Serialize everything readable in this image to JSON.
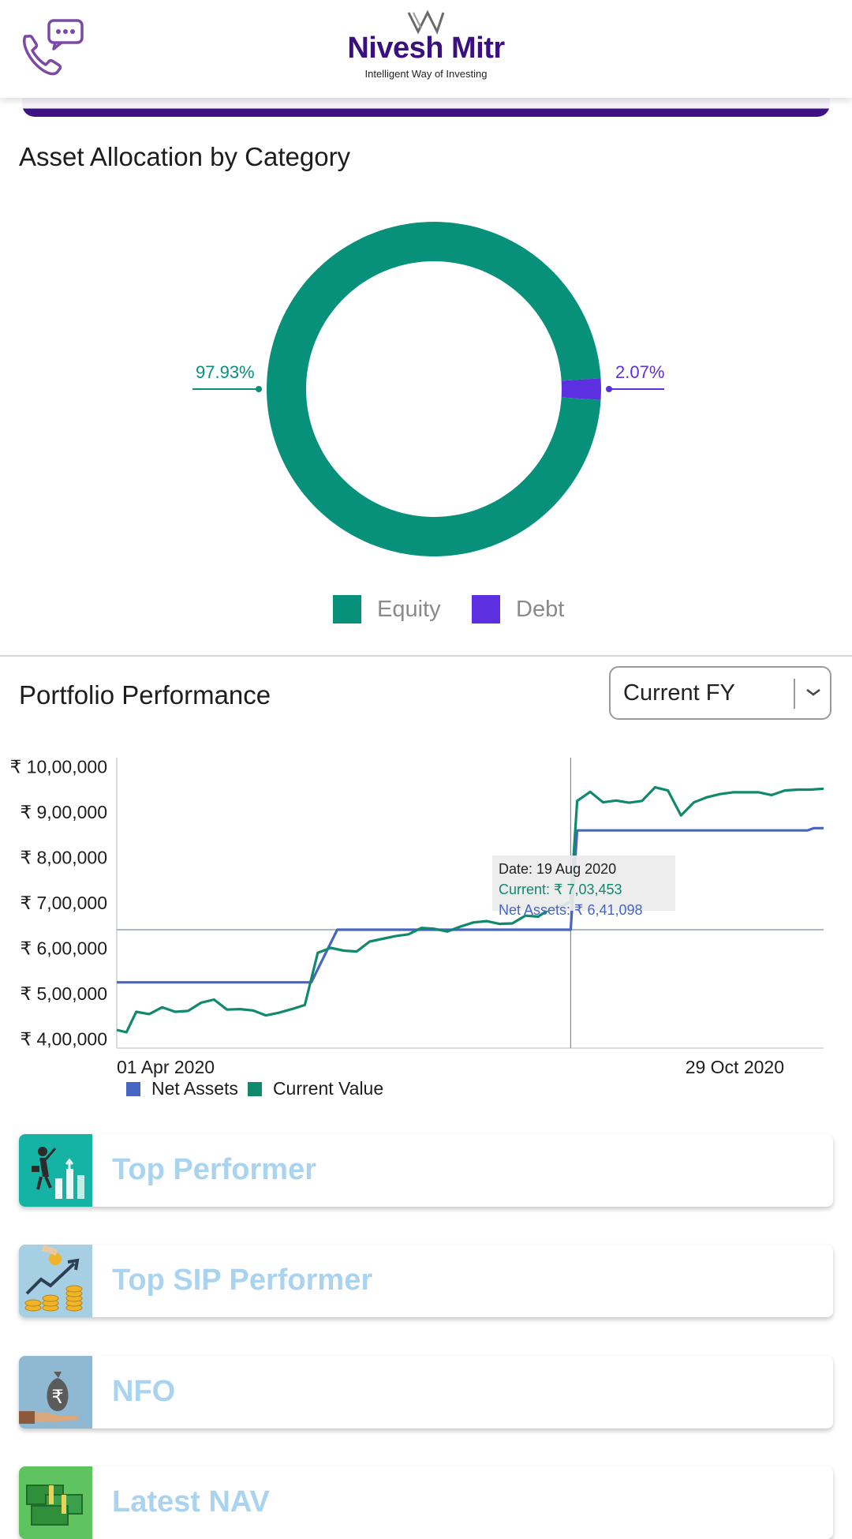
{
  "header": {
    "brand_name": "Nivesh Mitr",
    "brand_tagline": "Intelligent Way of Investing"
  },
  "asset_allocation": {
    "title": "Asset Allocation by Category",
    "equity_label": "97.93%",
    "debt_label": "2.07%",
    "legend": [
      {
        "name": "Equity",
        "color": "#07917a"
      },
      {
        "name": "Debt",
        "color": "#5c2fe0"
      }
    ]
  },
  "performance": {
    "title": "Portfolio Performance",
    "period_select": {
      "value": "Current FY"
    },
    "tooltip": {
      "date": "Date: 19 Aug 2020",
      "current": "Current: ₹ 7,03,453",
      "net_assets": "Net Assets: ₹ 6,41,098"
    },
    "legend": [
      {
        "name": "Net Assets",
        "color": "#4766c1"
      },
      {
        "name": "Current Value",
        "color": "#10896d"
      }
    ]
  },
  "chart_data": [
    {
      "type": "pie",
      "title": "Asset Allocation by Category",
      "categories": [
        "Equity",
        "Debt"
      ],
      "values": [
        97.93,
        2.07
      ],
      "data_labels": [
        "97.93%",
        "2.07%"
      ],
      "colors": [
        "#07917a",
        "#5c2fe0"
      ],
      "legend": "bottom-center",
      "donut": true
    },
    {
      "type": "line",
      "title": "Portfolio Performance",
      "y_tick_labels": [
        "₹ 10,00,000",
        "₹ 9,00,000",
        "₹ 8,00,000",
        "₹ 7,00,000",
        "₹ 6,00,000",
        "₹ 5,00,000",
        "₹ 4,00,000"
      ],
      "x_tick_labels": [
        "01 Apr 2020",
        "29 Oct 2020"
      ],
      "ylim": [
        380000,
        1010000
      ],
      "xlim": [
        "2020-04-01",
        "2020-11-05"
      ],
      "grid": false,
      "legend": "bottom-left",
      "crosshair": {
        "x": "2020-08-19",
        "y": 641098
      },
      "series": [
        {
          "name": "Net Assets",
          "color": "#4766c1",
          "points": [
            [
              "2020-04-01",
              525000
            ],
            [
              "2020-05-31",
              525000
            ],
            [
              "2020-06-08",
              641098
            ],
            [
              "2020-08-19",
              641098
            ],
            [
              "2020-08-21",
              860000
            ],
            [
              "2020-10-31",
              860000
            ],
            [
              "2020-11-02",
              865000
            ],
            [
              "2020-11-05",
              865000
            ]
          ]
        },
        {
          "name": "Current Value",
          "color": "#10896d",
          "points": [
            [
              "2020-04-01",
              420000
            ],
            [
              "2020-04-04",
              415000
            ],
            [
              "2020-04-07",
              460000
            ],
            [
              "2020-04-11",
              455000
            ],
            [
              "2020-04-15",
              470000
            ],
            [
              "2020-04-19",
              460000
            ],
            [
              "2020-04-23",
              462000
            ],
            [
              "2020-04-27",
              480000
            ],
            [
              "2020-05-01",
              487000
            ],
            [
              "2020-05-05",
              465000
            ],
            [
              "2020-05-09",
              466000
            ],
            [
              "2020-05-13",
              463000
            ],
            [
              "2020-05-17",
              452000
            ],
            [
              "2020-05-21",
              458000
            ],
            [
              "2020-05-25",
              466000
            ],
            [
              "2020-05-29",
              475000
            ],
            [
              "2020-06-02",
              590000
            ],
            [
              "2020-06-06",
              601000
            ],
            [
              "2020-06-10",
              595000
            ],
            [
              "2020-06-14",
              593000
            ],
            [
              "2020-06-18",
              615000
            ],
            [
              "2020-06-22",
              621000
            ],
            [
              "2020-06-26",
              627000
            ],
            [
              "2020-06-30",
              631000
            ],
            [
              "2020-07-04",
              645000
            ],
            [
              "2020-07-08",
              643000
            ],
            [
              "2020-07-12",
              637000
            ],
            [
              "2020-07-16",
              648000
            ],
            [
              "2020-07-20",
              657000
            ],
            [
              "2020-07-24",
              660000
            ],
            [
              "2020-07-28",
              654000
            ],
            [
              "2020-08-01",
              655000
            ],
            [
              "2020-08-05",
              672000
            ],
            [
              "2020-08-09",
              670000
            ],
            [
              "2020-08-13",
              689000
            ],
            [
              "2020-08-17",
              695000
            ],
            [
              "2020-08-19",
              703453
            ],
            [
              "2020-08-21",
              925000
            ],
            [
              "2020-08-25",
              945000
            ],
            [
              "2020-08-29",
              922000
            ],
            [
              "2020-09-02",
              926000
            ],
            [
              "2020-09-06",
              921000
            ],
            [
              "2020-09-10",
              925000
            ],
            [
              "2020-09-14",
              955000
            ],
            [
              "2020-09-18",
              948000
            ],
            [
              "2020-09-22",
              893000
            ],
            [
              "2020-09-26",
              922000
            ],
            [
              "2020-09-30",
              933000
            ],
            [
              "2020-10-04",
              940000
            ],
            [
              "2020-10-08",
              944000
            ],
            [
              "2020-10-12",
              944000
            ],
            [
              "2020-10-16",
              944000
            ],
            [
              "2020-10-20",
              938000
            ],
            [
              "2020-10-24",
              948000
            ],
            [
              "2020-10-28",
              950000
            ],
            [
              "2020-11-01",
              950000
            ],
            [
              "2020-11-05",
              952000
            ]
          ]
        }
      ]
    }
  ],
  "menu": [
    {
      "label": "Top Performer",
      "icon": "top-performer-icon",
      "thumb_color": "#14b3a4"
    },
    {
      "label": "Top SIP Performer",
      "icon": "sip-coins-icon",
      "thumb_color": "#a6cfe3"
    },
    {
      "label": "NFO",
      "icon": "money-bag-icon",
      "thumb_color": "#8fb9d2"
    },
    {
      "label": "Latest NAV",
      "icon": "cash-stack-icon",
      "thumb_color": "#5fc35f"
    }
  ]
}
